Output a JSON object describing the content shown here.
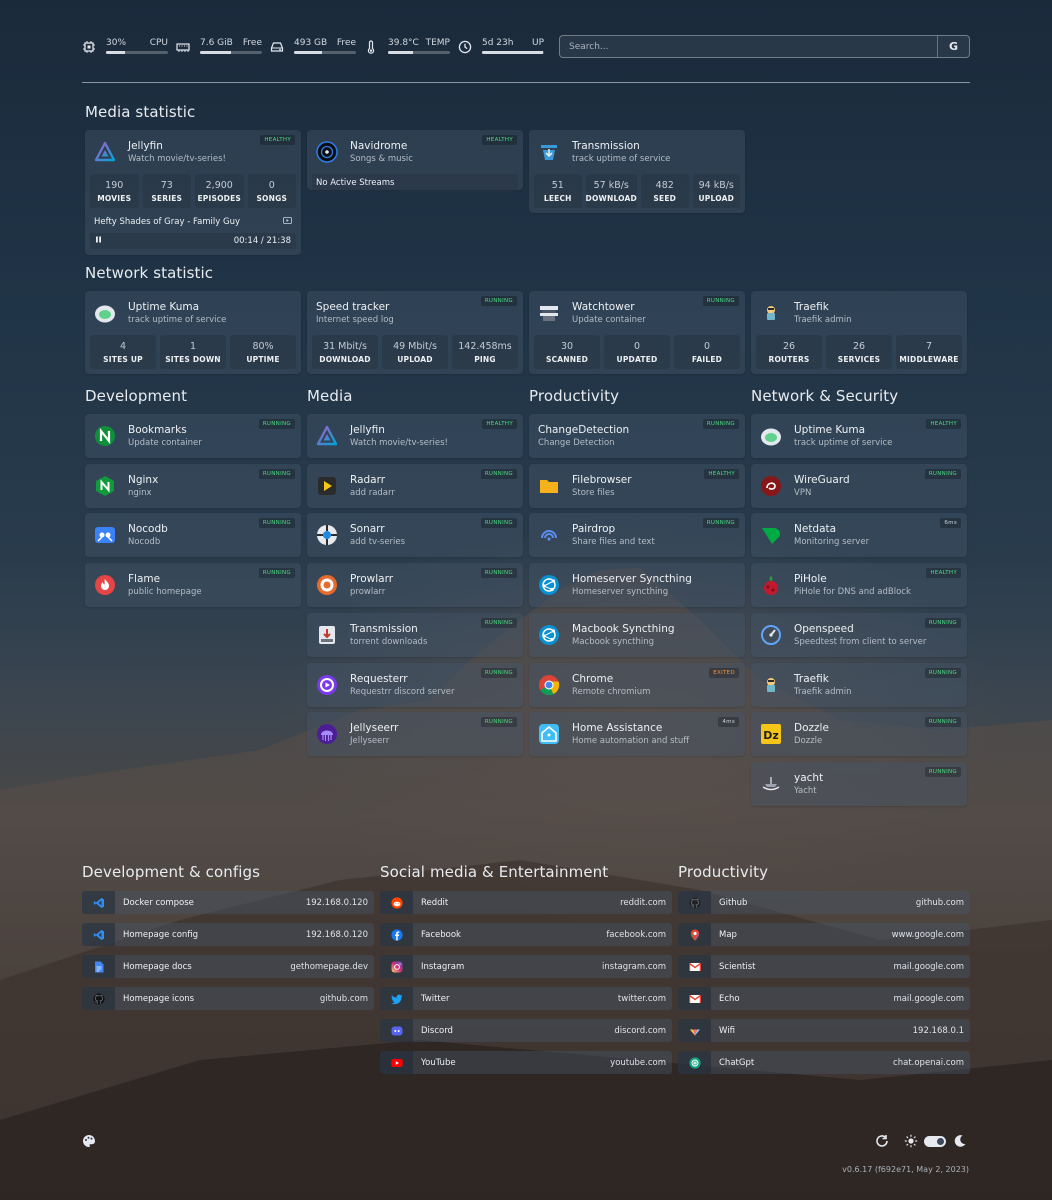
{
  "widgets": {
    "cpu": {
      "value": "30%",
      "label": "CPU",
      "fill": 0.3
    },
    "mem": {
      "value": "7.6 GiB",
      "label": "Free",
      "fill": 0.5
    },
    "disk": {
      "value": "493 GB",
      "label": "Free",
      "fill": 0.45
    },
    "temp": {
      "value": "39.8°C",
      "label": "TEMP",
      "fill": 0.4
    },
    "uptime": {
      "value": "5d 23h",
      "label": "UP",
      "fill": 0.98
    }
  },
  "search": {
    "placeholder": "Search...",
    "button": "G"
  },
  "sections": {
    "media_statistic": "Media statistic",
    "network_statistic": "Network statistic",
    "development": "Development",
    "media": "Media",
    "productivity": "Productivity",
    "network_security": "Network & Security"
  },
  "media_stats": {
    "jellyfin": {
      "name": "Jellyfin",
      "desc": "Watch movie/tv-series!",
      "badge": "HEALTHY",
      "stats": [
        {
          "v": "190",
          "l": "MOVIES"
        },
        {
          "v": "73",
          "l": "SERIES"
        },
        {
          "v": "2,900",
          "l": "EPISODES"
        },
        {
          "v": "0",
          "l": "SONGS"
        }
      ],
      "now_playing": "Hefty Shades of Gray - Family Guy",
      "time": "00:14 / 21:38"
    },
    "navidrome": {
      "name": "Navidrome",
      "desc": "Songs & music",
      "badge": "HEALTHY",
      "streams": "No Active Streams"
    },
    "transmission": {
      "name": "Transmission",
      "desc": "track uptime of service",
      "stats": [
        {
          "v": "51",
          "l": "LEECH"
        },
        {
          "v": "57 kB/s",
          "l": "DOWNLOAD"
        },
        {
          "v": "482",
          "l": "SEED"
        },
        {
          "v": "94 kB/s",
          "l": "UPLOAD"
        }
      ]
    }
  },
  "network_stats": {
    "uptime_kuma": {
      "name": "Uptime Kuma",
      "desc": "track uptime of service",
      "stats": [
        {
          "v": "4",
          "l": "SITES UP"
        },
        {
          "v": "1",
          "l": "SITES DOWN"
        },
        {
          "v": "80%",
          "l": "UPTIME"
        }
      ]
    },
    "speed": {
      "name": "Speed tracker",
      "desc": "Internet speed log",
      "badge": "RUNNING",
      "stats": [
        {
          "v": "31 Mbit/s",
          "l": "DOWNLOAD"
        },
        {
          "v": "49 Mbit/s",
          "l": "UPLOAD"
        },
        {
          "v": "142.458ms",
          "l": "PING"
        }
      ]
    },
    "watchtower": {
      "name": "Watchtower",
      "desc": "Update container",
      "badge": "RUNNING",
      "stats": [
        {
          "v": "30",
          "l": "SCANNED"
        },
        {
          "v": "0",
          "l": "UPDATED"
        },
        {
          "v": "0",
          "l": "FAILED"
        }
      ]
    },
    "traefik": {
      "name": "Traefik",
      "desc": "Traefik admin",
      "stats": [
        {
          "v": "26",
          "l": "ROUTERS"
        },
        {
          "v": "26",
          "l": "SERVICES"
        },
        {
          "v": "7",
          "l": "MIDDLEWARE"
        }
      ]
    }
  },
  "development": [
    {
      "name": "Bookmarks",
      "desc": "Update container",
      "badge": "RUNNING"
    },
    {
      "name": "Nginx",
      "desc": "nginx",
      "badge": "RUNNING"
    },
    {
      "name": "Nocodb",
      "desc": "Nocodb",
      "badge": "RUNNING"
    },
    {
      "name": "Flame",
      "desc": "public homepage",
      "badge": "RUNNING"
    }
  ],
  "media": [
    {
      "name": "Jellyfin",
      "desc": "Watch movie/tv-series!",
      "badge": "HEALTHY"
    },
    {
      "name": "Radarr",
      "desc": "add radarr",
      "badge": "RUNNING"
    },
    {
      "name": "Sonarr",
      "desc": "add tv-series",
      "badge": "RUNNING"
    },
    {
      "name": "Prowlarr",
      "desc": "prowlarr",
      "badge": "RUNNING"
    },
    {
      "name": "Transmission",
      "desc": "torrent downloads",
      "badge": "RUNNING"
    },
    {
      "name": "Requesterr",
      "desc": "Requestrr discord server",
      "badge": "RUNNING"
    },
    {
      "name": "Jellyseerr",
      "desc": "Jellyseerr",
      "badge": "RUNNING"
    }
  ],
  "productivity": [
    {
      "name": "ChangeDetection",
      "desc": "Change Detection",
      "badge": "RUNNING"
    },
    {
      "name": "Filebrowser",
      "desc": "Store files",
      "badge": "HEALTHY"
    },
    {
      "name": "Pairdrop",
      "desc": "Share files and text",
      "badge": "RUNNING"
    },
    {
      "name": "Homeserver Syncthing",
      "desc": "Homeserver syncthing",
      "badge": ""
    },
    {
      "name": "Macbook Syncthing",
      "desc": "Macbook syncthing",
      "badge": ""
    },
    {
      "name": "Chrome",
      "desc": "Remote chromium",
      "badge": "EXITED"
    },
    {
      "name": "Home Assistance",
      "desc": "Home automation and stuff",
      "badge": "4ms"
    }
  ],
  "network_security": [
    {
      "name": "Uptime Kuma",
      "desc": "track uptime of service",
      "badge": "HEALTHY"
    },
    {
      "name": "WireGuard",
      "desc": "VPN",
      "badge": "RUNNING"
    },
    {
      "name": "Netdata",
      "desc": "Monitoring server",
      "badge": "6ms"
    },
    {
      "name": "PiHole",
      "desc": "PiHole for DNS and adBlock",
      "badge": "HEALTHY"
    },
    {
      "name": "Openspeed",
      "desc": "Speedtest from client to server",
      "badge": "RUNNING"
    },
    {
      "name": "Traefik",
      "desc": "Traefik admin",
      "badge": "RUNNING"
    },
    {
      "name": "Dozzle",
      "desc": "Dozzle",
      "badge": "RUNNING"
    },
    {
      "name": "yacht",
      "desc": "Yacht",
      "badge": "RUNNING"
    }
  ],
  "bookmark_groups": {
    "dev": {
      "title": "Development & configs",
      "items": [
        {
          "name": "Docker compose",
          "url": "192.168.0.120"
        },
        {
          "name": "Homepage config",
          "url": "192.168.0.120"
        },
        {
          "name": "Homepage docs",
          "url": "gethomepage.dev"
        },
        {
          "name": "Homepage icons",
          "url": "github.com"
        }
      ]
    },
    "social": {
      "title": "Social media & Entertainment",
      "items": [
        {
          "name": "Reddit",
          "url": "reddit.com"
        },
        {
          "name": "Facebook",
          "url": "facebook.com"
        },
        {
          "name": "Instagram",
          "url": "instagram.com"
        },
        {
          "name": "Twitter",
          "url": "twitter.com"
        },
        {
          "name": "Discord",
          "url": "discord.com"
        },
        {
          "name": "YouTube",
          "url": "youtube.com"
        }
      ]
    },
    "prod": {
      "title": "Productivity",
      "items": [
        {
          "name": "Github",
          "url": "github.com"
        },
        {
          "name": "Map",
          "url": "www.google.com"
        },
        {
          "name": "Scientist",
          "url": "mail.google.com"
        },
        {
          "name": "Echo",
          "url": "mail.google.com"
        },
        {
          "name": "Wifi",
          "url": "192.168.0.1"
        },
        {
          "name": "ChatGpt",
          "url": "chat.openai.com"
        }
      ]
    }
  },
  "footer": {
    "version": "v0.6.17 (f692e71, May 2, 2023)"
  },
  "colors": {
    "healthy": "#4ade80",
    "exited": "#fb923c",
    "card": "#46566a"
  }
}
